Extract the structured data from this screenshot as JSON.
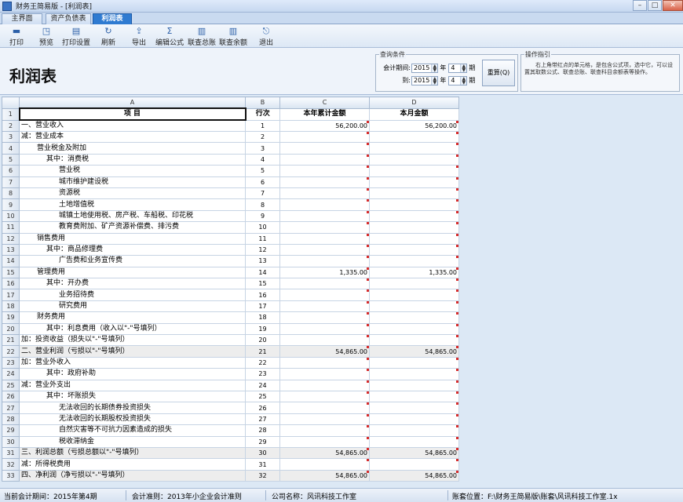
{
  "window": {
    "title": "财务王简易版 - [利润表]"
  },
  "tabs": [
    "主界面",
    "资产负债表",
    "利润表"
  ],
  "toolbar": [
    {
      "label": "打印",
      "icon": "printer-icon",
      "glyph": "▬"
    },
    {
      "label": "预览",
      "icon": "preview-icon",
      "glyph": "◳"
    },
    {
      "label": "打印设置",
      "icon": "print-settings-icon",
      "glyph": "▤"
    },
    {
      "label": "刷新",
      "icon": "refresh-icon",
      "glyph": "↻"
    },
    {
      "label": "导出",
      "icon": "export-icon",
      "glyph": "⇪"
    },
    {
      "label": "编辑公式",
      "icon": "formula-icon",
      "glyph": "Σ"
    },
    {
      "label": "联查总账",
      "icon": "ledger-icon",
      "glyph": "▥"
    },
    {
      "label": "联查余额",
      "icon": "balance-icon",
      "glyph": "▥"
    },
    {
      "label": "退出",
      "icon": "exit-icon",
      "glyph": "⎋"
    }
  ],
  "report": {
    "title": "利润表"
  },
  "query": {
    "legend": "查询条件",
    "period_label": "会计期间:",
    "to_label": "到:",
    "from_year": "2015",
    "from_month": "4",
    "to_year": "2015",
    "to_month": "4",
    "year_unit": "年",
    "month_unit": "期",
    "reset_label": "重算(Q)"
  },
  "guide": {
    "legend": "操作指引",
    "text": "右上角带红点的单元格，是包含公式项，选中它，可以设置其取数公式、联查总账、联查科目余额表等操作。"
  },
  "sheet": {
    "columns": [
      "A",
      "B",
      "C",
      "D"
    ],
    "headers": [
      "项    目",
      "行次",
      "本年累计金额",
      "本月金额"
    ],
    "rows": [
      {
        "item": "一、营业收入",
        "no": "1",
        "ytd": "56,200.00",
        "month": "56,200.00",
        "indent": 0
      },
      {
        "item": "减：营业成本",
        "no": "2",
        "ytd": "",
        "month": "",
        "indent": 0
      },
      {
        "item": "营业税金及附加",
        "no": "3",
        "ytd": "",
        "month": "",
        "indent": 1
      },
      {
        "item": "其中：消费税",
        "no": "4",
        "ytd": "",
        "month": "",
        "indent": 2
      },
      {
        "item": "营业税",
        "no": "5",
        "ytd": "",
        "month": "",
        "indent": 3
      },
      {
        "item": "城市维护建设税",
        "no": "6",
        "ytd": "",
        "month": "",
        "indent": 3
      },
      {
        "item": "资源税",
        "no": "7",
        "ytd": "",
        "month": "",
        "indent": 3
      },
      {
        "item": "土地增值税",
        "no": "8",
        "ytd": "",
        "month": "",
        "indent": 3
      },
      {
        "item": "城镇土地使用税、房产税、车船税、印花税",
        "no": "9",
        "ytd": "",
        "month": "",
        "indent": 3
      },
      {
        "item": "教育费附加、矿产资源补偿费、排污费",
        "no": "10",
        "ytd": "",
        "month": "",
        "indent": 3
      },
      {
        "item": "销售费用",
        "no": "11",
        "ytd": "",
        "month": "",
        "indent": 1
      },
      {
        "item": "其中：商品修理费",
        "no": "12",
        "ytd": "",
        "month": "",
        "indent": 2
      },
      {
        "item": "广告费和业务宣传费",
        "no": "13",
        "ytd": "",
        "month": "",
        "indent": 3
      },
      {
        "item": "管理费用",
        "no": "14",
        "ytd": "1,335.00",
        "month": "1,335.00",
        "indent": 1
      },
      {
        "item": "其中：开办费",
        "no": "15",
        "ytd": "",
        "month": "",
        "indent": 2
      },
      {
        "item": "业务招待费",
        "no": "16",
        "ytd": "",
        "month": "",
        "indent": 3
      },
      {
        "item": "研究费用",
        "no": "17",
        "ytd": "",
        "month": "",
        "indent": 3
      },
      {
        "item": "财务费用",
        "no": "18",
        "ytd": "",
        "month": "",
        "indent": 1
      },
      {
        "item": "其中：利息费用（收入以\"-\"号填列）",
        "no": "19",
        "ytd": "",
        "month": "",
        "indent": 2
      },
      {
        "item": "加：投资收益（损失以\"-\"号填列）",
        "no": "20",
        "ytd": "",
        "month": "",
        "indent": 0
      },
      {
        "item": "二、营业利润（亏损以\"-\"号填列）",
        "no": "21",
        "ytd": "54,865.00",
        "month": "54,865.00",
        "indent": 0,
        "shade": true
      },
      {
        "item": "加：营业外收入",
        "no": "22",
        "ytd": "",
        "month": "",
        "indent": 0
      },
      {
        "item": "其中：政府补助",
        "no": "23",
        "ytd": "",
        "month": "",
        "indent": 2
      },
      {
        "item": "减：营业外支出",
        "no": "24",
        "ytd": "",
        "month": "",
        "indent": 0
      },
      {
        "item": "其中：坏账损失",
        "no": "25",
        "ytd": "",
        "month": "",
        "indent": 2
      },
      {
        "item": "无法收回的长期债券投资损失",
        "no": "26",
        "ytd": "",
        "month": "",
        "indent": 3
      },
      {
        "item": "无法收回的长期股权投资损失",
        "no": "27",
        "ytd": "",
        "month": "",
        "indent": 3
      },
      {
        "item": "自然灾害等不可抗力因素造成的损失",
        "no": "28",
        "ytd": "",
        "month": "",
        "indent": 3
      },
      {
        "item": "税收滞纳金",
        "no": "29",
        "ytd": "",
        "month": "",
        "indent": 3
      },
      {
        "item": "三、利润总额（亏损总额以\"-\"号填列）",
        "no": "30",
        "ytd": "54,865.00",
        "month": "54,865.00",
        "indent": 0,
        "shade": true
      },
      {
        "item": "减：所得税费用",
        "no": "31",
        "ytd": "",
        "month": "",
        "indent": 0
      },
      {
        "item": "四、净利润（净亏损以\"-\"号填列）",
        "no": "32",
        "ytd": "54,865.00",
        "month": "54,865.00",
        "indent": 0,
        "shade": true
      }
    ]
  },
  "status": {
    "period": "当前会计期间：2015年第4期",
    "standard": "会计准则：2013年小企业会计准则",
    "company": "公司名称：风讯科技工作室",
    "path": "账套位置：F:\\财务王简易版\\账套\\风讯科技工作室.1x"
  }
}
